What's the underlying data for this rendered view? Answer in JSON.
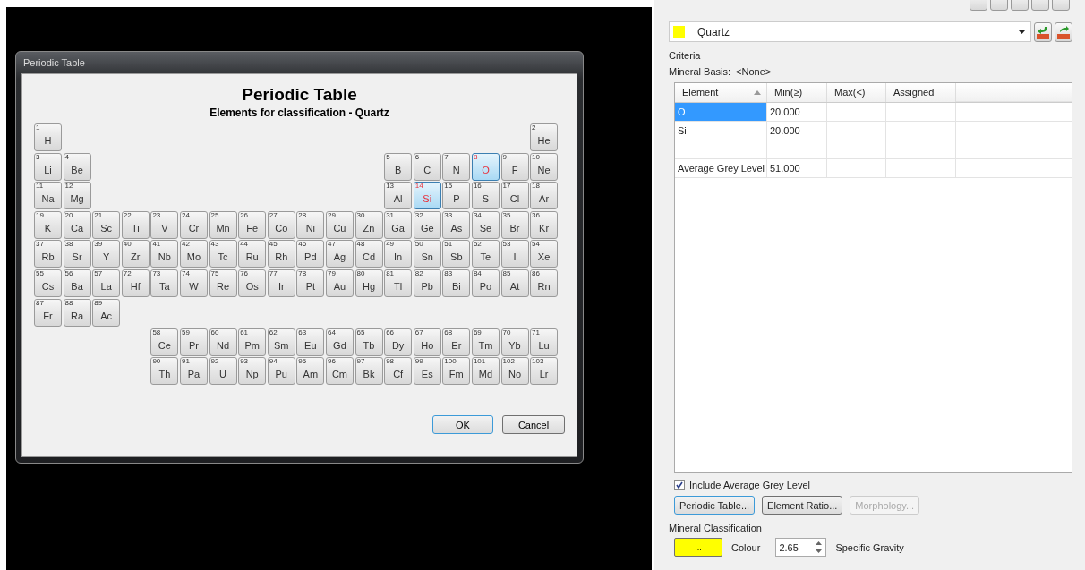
{
  "dialog": {
    "title": "Periodic Table",
    "heading": "Periodic Table",
    "subheading": "Elements for classification - Quartz",
    "main_rows": [
      [
        {
          "n": "1",
          "s": "H",
          "selected": false
        },
        {
          "n": "2",
          "s": "He",
          "selected": false
        }
      ],
      [
        {
          "n": "3",
          "s": "Li",
          "selected": false
        },
        {
          "n": "4",
          "s": "Be",
          "selected": false
        },
        {
          "n": "5",
          "s": "B",
          "selected": false
        },
        {
          "n": "6",
          "s": "C",
          "selected": false
        },
        {
          "n": "7",
          "s": "N",
          "selected": false
        },
        {
          "n": "8",
          "s": "O",
          "selected": true
        },
        {
          "n": "9",
          "s": "F",
          "selected": false
        },
        {
          "n": "10",
          "s": "Ne",
          "selected": false
        }
      ],
      [
        {
          "n": "11",
          "s": "Na",
          "selected": false
        },
        {
          "n": "12",
          "s": "Mg",
          "selected": false
        },
        {
          "n": "13",
          "s": "Al",
          "selected": false
        },
        {
          "n": "14",
          "s": "Si",
          "selected": true
        },
        {
          "n": "15",
          "s": "P",
          "selected": false
        },
        {
          "n": "16",
          "s": "S",
          "selected": false
        },
        {
          "n": "17",
          "s": "Cl",
          "selected": false
        },
        {
          "n": "18",
          "s": "Ar",
          "selected": false
        }
      ],
      [
        {
          "n": "19",
          "s": "K",
          "selected": false
        },
        {
          "n": "20",
          "s": "Ca",
          "selected": false
        },
        {
          "n": "21",
          "s": "Sc",
          "selected": false
        },
        {
          "n": "22",
          "s": "Ti",
          "selected": false
        },
        {
          "n": "23",
          "s": "V",
          "selected": false
        },
        {
          "n": "24",
          "s": "Cr",
          "selected": false
        },
        {
          "n": "25",
          "s": "Mn",
          "selected": false
        },
        {
          "n": "26",
          "s": "Fe",
          "selected": false
        },
        {
          "n": "27",
          "s": "Co",
          "selected": false
        },
        {
          "n": "28",
          "s": "Ni",
          "selected": false
        },
        {
          "n": "29",
          "s": "Cu",
          "selected": false
        },
        {
          "n": "30",
          "s": "Zn",
          "selected": false
        },
        {
          "n": "31",
          "s": "Ga",
          "selected": false
        },
        {
          "n": "32",
          "s": "Ge",
          "selected": false
        },
        {
          "n": "33",
          "s": "As",
          "selected": false
        },
        {
          "n": "34",
          "s": "Se",
          "selected": false
        },
        {
          "n": "35",
          "s": "Br",
          "selected": false
        },
        {
          "n": "36",
          "s": "Kr",
          "selected": false
        }
      ],
      [
        {
          "n": "37",
          "s": "Rb",
          "selected": false
        },
        {
          "n": "38",
          "s": "Sr",
          "selected": false
        },
        {
          "n": "39",
          "s": "Y",
          "selected": false
        },
        {
          "n": "40",
          "s": "Zr",
          "selected": false
        },
        {
          "n": "41",
          "s": "Nb",
          "selected": false
        },
        {
          "n": "42",
          "s": "Mo",
          "selected": false
        },
        {
          "n": "43",
          "s": "Tc",
          "selected": false
        },
        {
          "n": "44",
          "s": "Ru",
          "selected": false
        },
        {
          "n": "45",
          "s": "Rh",
          "selected": false
        },
        {
          "n": "46",
          "s": "Pd",
          "selected": false
        },
        {
          "n": "47",
          "s": "Ag",
          "selected": false
        },
        {
          "n": "48",
          "s": "Cd",
          "selected": false
        },
        {
          "n": "49",
          "s": "In",
          "selected": false
        },
        {
          "n": "50",
          "s": "Sn",
          "selected": false
        },
        {
          "n": "51",
          "s": "Sb",
          "selected": false
        },
        {
          "n": "52",
          "s": "Te",
          "selected": false
        },
        {
          "n": "53",
          "s": "I",
          "selected": false
        },
        {
          "n": "54",
          "s": "Xe",
          "selected": false
        }
      ],
      [
        {
          "n": "55",
          "s": "Cs",
          "selected": false
        },
        {
          "n": "56",
          "s": "Ba",
          "selected": false
        },
        {
          "n": "57",
          "s": "La",
          "selected": false
        },
        {
          "n": "72",
          "s": "Hf",
          "selected": false
        },
        {
          "n": "73",
          "s": "Ta",
          "selected": false
        },
        {
          "n": "74",
          "s": "W",
          "selected": false
        },
        {
          "n": "75",
          "s": "Re",
          "selected": false
        },
        {
          "n": "76",
          "s": "Os",
          "selected": false
        },
        {
          "n": "77",
          "s": "Ir",
          "selected": false
        },
        {
          "n": "78",
          "s": "Pt",
          "selected": false
        },
        {
          "n": "79",
          "s": "Au",
          "selected": false
        },
        {
          "n": "80",
          "s": "Hg",
          "selected": false
        },
        {
          "n": "81",
          "s": "Tl",
          "selected": false
        },
        {
          "n": "82",
          "s": "Pb",
          "selected": false
        },
        {
          "n": "83",
          "s": "Bi",
          "selected": false
        },
        {
          "n": "84",
          "s": "Po",
          "selected": false
        },
        {
          "n": "85",
          "s": "At",
          "selected": false
        },
        {
          "n": "86",
          "s": "Rn",
          "selected": false
        }
      ],
      [
        {
          "n": "87",
          "s": "Fr",
          "selected": false
        },
        {
          "n": "88",
          "s": "Ra",
          "selected": false
        },
        {
          "n": "89",
          "s": "Ac",
          "selected": false
        }
      ]
    ],
    "f_rows": [
      [
        {
          "n": "58",
          "s": "Ce",
          "selected": false
        },
        {
          "n": "59",
          "s": "Pr",
          "selected": false
        },
        {
          "n": "60",
          "s": "Nd",
          "selected": false
        },
        {
          "n": "61",
          "s": "Pm",
          "selected": false
        },
        {
          "n": "62",
          "s": "Sm",
          "selected": false
        },
        {
          "n": "63",
          "s": "Eu",
          "selected": false
        },
        {
          "n": "64",
          "s": "Gd",
          "selected": false
        },
        {
          "n": "65",
          "s": "Tb",
          "selected": false
        },
        {
          "n": "66",
          "s": "Dy",
          "selected": false
        },
        {
          "n": "67",
          "s": "Ho",
          "selected": false
        },
        {
          "n": "68",
          "s": "Er",
          "selected": false
        },
        {
          "n": "69",
          "s": "Tm",
          "selected": false
        },
        {
          "n": "70",
          "s": "Yb",
          "selected": false
        },
        {
          "n": "71",
          "s": "Lu",
          "selected": false
        }
      ],
      [
        {
          "n": "90",
          "s": "Th",
          "selected": false
        },
        {
          "n": "91",
          "s": "Pa",
          "selected": false
        },
        {
          "n": "92",
          "s": "U",
          "selected": false
        },
        {
          "n": "93",
          "s": "Np",
          "selected": false
        },
        {
          "n": "94",
          "s": "Pu",
          "selected": false
        },
        {
          "n": "95",
          "s": "Am",
          "selected": false
        },
        {
          "n": "96",
          "s": "Cm",
          "selected": false
        },
        {
          "n": "97",
          "s": "Bk",
          "selected": false
        },
        {
          "n": "98",
          "s": "Cf",
          "selected": false
        },
        {
          "n": "99",
          "s": "Es",
          "selected": false
        },
        {
          "n": "100",
          "s": "Fm",
          "selected": false
        },
        {
          "n": "101",
          "s": "Md",
          "selected": false
        },
        {
          "n": "102",
          "s": "No",
          "selected": false
        },
        {
          "n": "103",
          "s": "Lr",
          "selected": false
        }
      ]
    ],
    "buttons": [
      "OK",
      "Cancel"
    ]
  },
  "panel": {
    "mineral": {
      "name": "Quartz",
      "color": "#ffff00"
    },
    "criteria": {
      "title": "Criteria",
      "basis_label": "Mineral Basis:",
      "basis_value": "<None>",
      "columns": [
        "Element",
        "Min(≥)",
        "Max(<)",
        "Assigned"
      ],
      "rows": [
        {
          "cells": [
            "O",
            "20.000",
            "",
            ""
          ],
          "selected": true
        },
        {
          "cells": [
            "Si",
            "20.000",
            "",
            ""
          ],
          "selected": false
        },
        {
          "cells": [
            "",
            "",
            "",
            ""
          ],
          "selected": false
        },
        {
          "cells": [
            "Average Grey Level",
            "51.000",
            "",
            ""
          ],
          "selected": false
        }
      ],
      "include_grey": {
        "label": "Include Average Grey Level",
        "checked": true
      },
      "buttons": [
        {
          "label": "Periodic Table...",
          "disabled": false
        },
        {
          "label": "Element Ratio...",
          "disabled": false
        },
        {
          "label": "Morphology...",
          "disabled": true
        }
      ]
    },
    "classification": {
      "title": "Mineral Classification",
      "color_button": "...",
      "color": "#ffff00",
      "colour_label": "Colour",
      "gravity": "2.65",
      "gravity_label": "Specific Gravity"
    }
  }
}
